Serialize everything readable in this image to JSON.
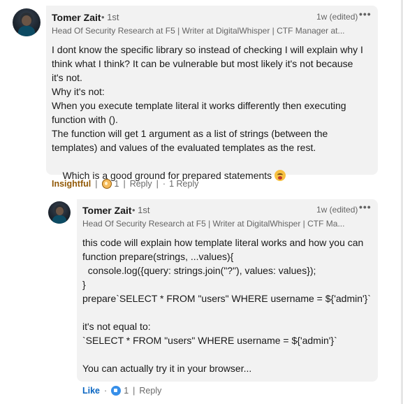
{
  "comment": {
    "author": "Tomer Zait",
    "degree": "• 1st",
    "headline": "Head Of Security Research at F5 | Writer at DigitalWhisper | CTF Manager at...",
    "time": "1w (edited)",
    "more_icon": "more-horizontal-icon",
    "lines": [
      "I dont know the specific library so instead of checking I will explain why I",
      "think what I think? It can be vulnerable but most likely it's not because",
      "it's not.",
      "Why it's not:",
      "When you execute template literal it works differently then executing",
      "function with ().",
      "The function will get 1 argument as a list of strings (between the",
      "templates) and values of the evaluated templates as the rest.",
      "Which is a good ground for prepared statements"
    ],
    "emoji_icon": "face-emoji-icon",
    "reaction_label": "Insightful",
    "reaction_icon": "insightful-bulb-icon",
    "reaction_count": "1",
    "reply_label": "Reply",
    "replies_label": "1 Reply",
    "separator": "|",
    "dot": "·"
  },
  "reply": {
    "author": "Tomer Zait",
    "degree": "• 1st",
    "headline": "Head Of Security Research at F5 | Writer at DigitalWhisper | CTF Ma...",
    "time": "1w (edited)",
    "more_icon": "more-horizontal-icon",
    "lines": [
      "this code will explain how template literal works and how you can",
      "function prepare(strings, ...values){",
      "  console.log({query: strings.join(\"?\"), values: values});",
      "}",
      "prepare`SELECT * FROM \"users\" WHERE username = ${'admin'}`",
      "",
      "it's not equal to:",
      "`SELECT * FROM \"users\" WHERE username = ${'admin'}`",
      "",
      "You can actually try it in your browser..."
    ],
    "like_label": "Like",
    "reaction_icon": "like-thumb-icon",
    "reaction_count": "1",
    "reply_label": "Reply",
    "separator": "|",
    "dot": "·"
  },
  "colors": {
    "bubble": "#f2f2f2",
    "insightful": "#915907",
    "like": "#0a66c2"
  }
}
